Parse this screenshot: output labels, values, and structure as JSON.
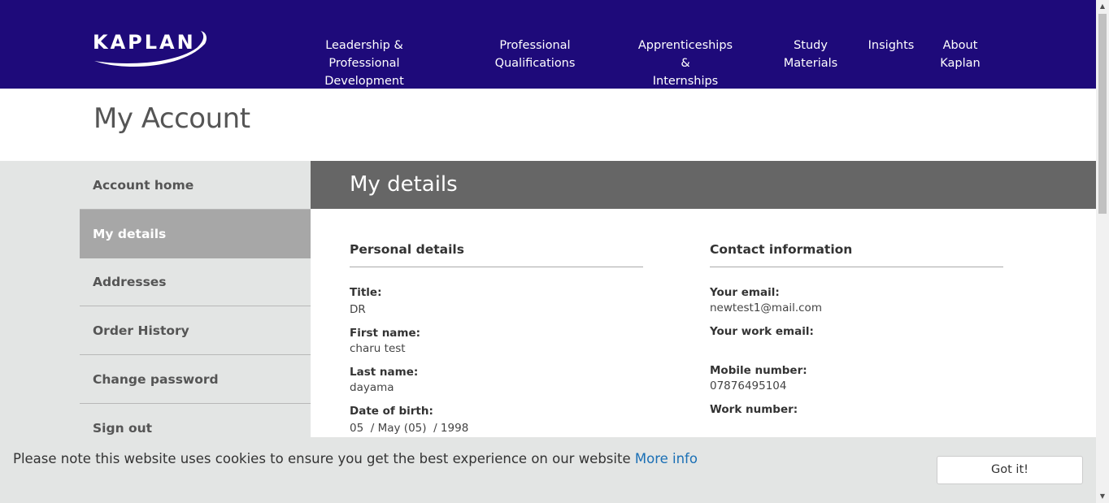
{
  "header": {
    "logo_text": "KAPLAN",
    "nav": [
      {
        "label": "Leadership & Professional\nDevelopment"
      },
      {
        "label": "Professional\nQualifications"
      },
      {
        "label": "Apprenticeships &\nInternships"
      },
      {
        "label": "Study\nMaterials"
      },
      {
        "label": "Insights"
      },
      {
        "label": "About\nKaplan"
      }
    ]
  },
  "page_title": "My Account",
  "sidebar": {
    "items": [
      {
        "label": "Account home"
      },
      {
        "label": "My details"
      },
      {
        "label": "Addresses"
      },
      {
        "label": "Order History"
      },
      {
        "label": "Change password"
      },
      {
        "label": "Sign out"
      }
    ],
    "active_index": 1
  },
  "content": {
    "title": "My details",
    "personal": {
      "heading": "Personal details",
      "title_label": "Title:",
      "title_value": "DR",
      "first_name_label": "First name:",
      "first_name_value": "charu test",
      "last_name_label": "Last name:",
      "last_name_value": "dayama",
      "dob_label": "Date of birth:",
      "dob_value": "05  / May (05)  / 1998"
    },
    "contact": {
      "heading": "Contact information",
      "email_label": "Your email:",
      "email_value": "newtest1@mail.com",
      "work_email_label": "Your work email:",
      "work_email_value": "",
      "mobile_label": "Mobile number:",
      "mobile_value": "07876495104",
      "work_number_label": "Work number:",
      "work_number_value": ""
    }
  },
  "cookie_bar": {
    "message": "Please note this website uses cookies to ensure you get the best experience on our website ",
    "link_text": "More info",
    "button_label": "Got it!"
  },
  "colors": {
    "header_bg": "#1e0a7a",
    "content_header_bg": "#666666",
    "sidebar_active_bg": "#a7a7a7",
    "link": "#1a6fb5"
  },
  "icons": {
    "scroll_up": "triangle-up",
    "scroll_down": "triangle-down"
  }
}
